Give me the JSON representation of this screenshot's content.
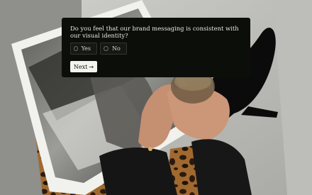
{
  "survey": {
    "question": "Do you feel that our brand messaging is consistent with our visual identity?",
    "options": [
      {
        "label": "Yes"
      },
      {
        "label": "No"
      }
    ],
    "next_label": "Next",
    "next_icon": "→"
  },
  "colors": {
    "card_background": "#0c0e0a",
    "card_text": "#e8e8e3",
    "button_background": "#f4f4ef"
  },
  "icons": {
    "next": "arrow-right-icon",
    "option_radio": "radio-circle-icon"
  }
}
